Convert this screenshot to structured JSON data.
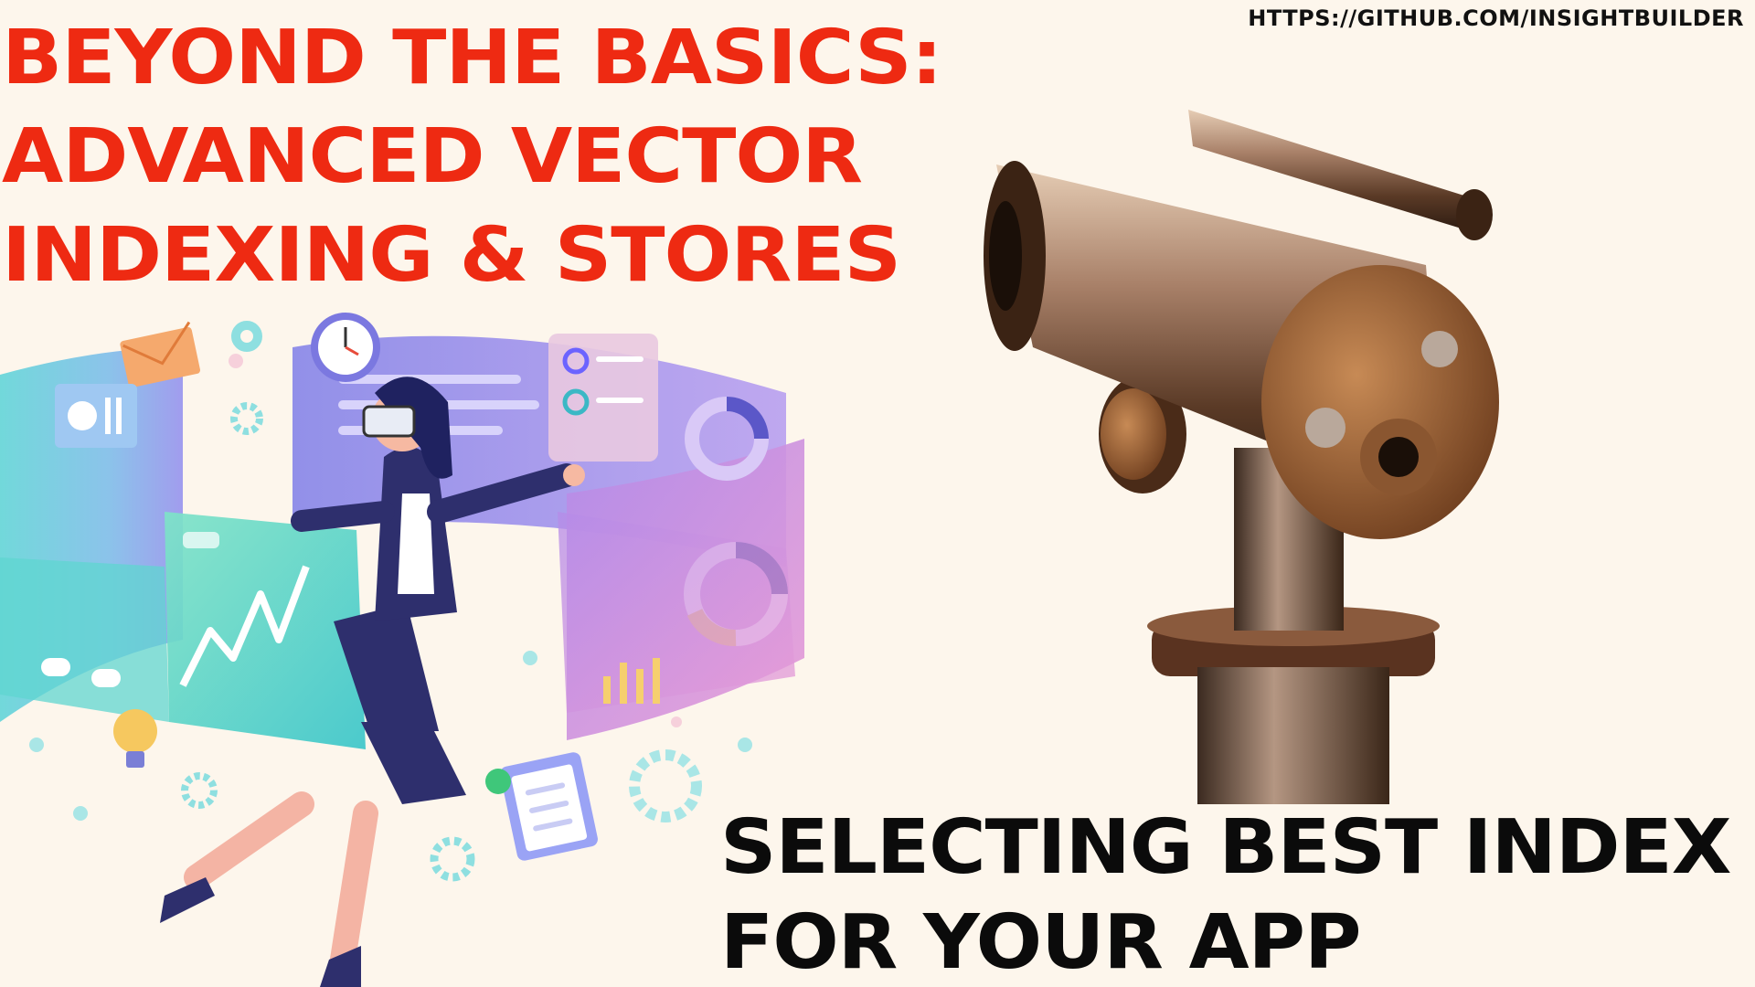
{
  "header": {
    "url": "HTTPS://GITHUB.COM/INSIGHTBUILDER",
    "title_lines": [
      "BEYOND THE BASICS:",
      "ADVANCED VECTOR",
      "INDEXING & STORES"
    ]
  },
  "footer": {
    "subtitle_lines": [
      "SELECTING BEST INDEX",
      "FOR YOUR APP"
    ]
  },
  "colors": {
    "background": "#fdf6ec",
    "title": "#ee2a12",
    "subtitle": "#0b0b0b"
  },
  "images": {
    "illustration": "woman-with-vr-headset-and-holographic-dashboard-illustration",
    "photo": "brass-telescope-photo"
  }
}
